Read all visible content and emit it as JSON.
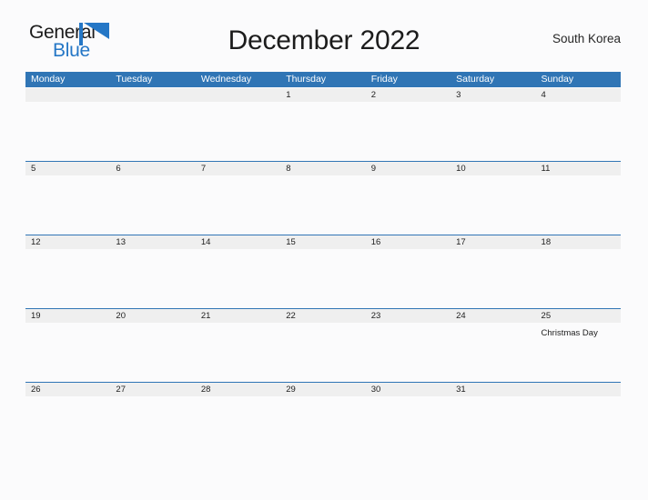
{
  "brand": {
    "name_part1": "General",
    "name_part2": "Blue",
    "flag_color": "#2577c6",
    "text_color": "#1b1b1b"
  },
  "header": {
    "title": "December 2022",
    "region": "South Korea"
  },
  "colors": {
    "header_blue": "#3075b5",
    "date_band_gray": "#efefef",
    "page_background": "#fbfbfc",
    "text": "#1d1d1d"
  },
  "calendar": {
    "month": "December",
    "year": "2022",
    "weekday_headers": [
      "Monday",
      "Tuesday",
      "Wednesday",
      "Thursday",
      "Friday",
      "Saturday",
      "Sunday"
    ],
    "weeks": [
      {
        "days": [
          {
            "number": "",
            "event": ""
          },
          {
            "number": "",
            "event": ""
          },
          {
            "number": "",
            "event": ""
          },
          {
            "number": "1",
            "event": ""
          },
          {
            "number": "2",
            "event": ""
          },
          {
            "number": "3",
            "event": ""
          },
          {
            "number": "4",
            "event": ""
          }
        ]
      },
      {
        "days": [
          {
            "number": "5",
            "event": ""
          },
          {
            "number": "6",
            "event": ""
          },
          {
            "number": "7",
            "event": ""
          },
          {
            "number": "8",
            "event": ""
          },
          {
            "number": "9",
            "event": ""
          },
          {
            "number": "10",
            "event": ""
          },
          {
            "number": "11",
            "event": ""
          }
        ]
      },
      {
        "days": [
          {
            "number": "12",
            "event": ""
          },
          {
            "number": "13",
            "event": ""
          },
          {
            "number": "14",
            "event": ""
          },
          {
            "number": "15",
            "event": ""
          },
          {
            "number": "16",
            "event": ""
          },
          {
            "number": "17",
            "event": ""
          },
          {
            "number": "18",
            "event": ""
          }
        ]
      },
      {
        "days": [
          {
            "number": "19",
            "event": ""
          },
          {
            "number": "20",
            "event": ""
          },
          {
            "number": "21",
            "event": ""
          },
          {
            "number": "22",
            "event": ""
          },
          {
            "number": "23",
            "event": ""
          },
          {
            "number": "24",
            "event": ""
          },
          {
            "number": "25",
            "event": "Christmas Day"
          }
        ]
      },
      {
        "days": [
          {
            "number": "26",
            "event": ""
          },
          {
            "number": "27",
            "event": ""
          },
          {
            "number": "28",
            "event": ""
          },
          {
            "number": "29",
            "event": ""
          },
          {
            "number": "30",
            "event": ""
          },
          {
            "number": "31",
            "event": ""
          },
          {
            "number": "",
            "event": ""
          }
        ]
      }
    ]
  }
}
